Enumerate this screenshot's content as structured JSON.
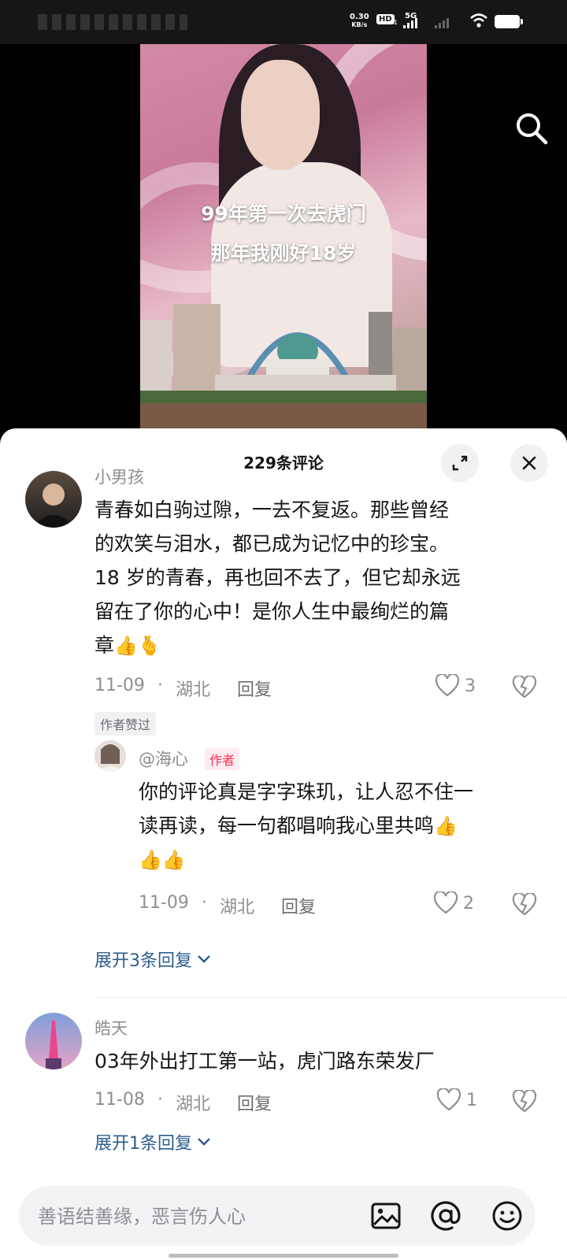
{
  "status_bar": {
    "net_speed_value": "0.30",
    "net_speed_unit": "KB/s",
    "hd_label": "HD",
    "hd_sub": "1",
    "network_label": "5G"
  },
  "video": {
    "caption_line1": "99年第一次去虎门",
    "caption_line2": "那年我刚好18岁"
  },
  "comments_sheet": {
    "title": "229条评论",
    "comments": [
      {
        "username": "小男孩",
        "text_lines": [
          "青春如白驹过隙，一去不复返。那些曾经",
          "的欢笑与泪水，都已成为记忆中的珍宝。",
          "18 岁的青春，再也回不去了，但它却永远",
          "留在了你的心中！是你人生中最绚烂的篇",
          "章"
        ],
        "emoji_inline": "👍🫰",
        "date": "11-09",
        "location": "湖北",
        "reply_label": "回复",
        "likes": "3",
        "badge": "作者赞过"
      },
      {
        "username": "@海心",
        "author_tag": "作者",
        "text_lines": [
          "你的评论真是字字珠玑，让人忍不住一",
          "读再读，每一句都唱响我心里共鸣"
        ],
        "emoji_inline": "👍",
        "emoji_line": "👍👍",
        "date": "11-09",
        "location": "湖北",
        "reply_label": "回复",
        "likes": "2"
      },
      {
        "expand_label": "展开3条回复"
      },
      {
        "username": "皓天",
        "text_lines": [
          "03年外出打工第一站，虎门路东荣发厂"
        ],
        "date": "11-08",
        "location": "湖北",
        "reply_label": "回复",
        "likes": "1",
        "expand_label": "展开1条回复"
      }
    ],
    "separator": "·"
  },
  "input_bar": {
    "placeholder": "善语结善缘，恶言伤人心"
  },
  "icons": [
    "search-icon",
    "fullscreen-icon",
    "close-icon",
    "heart-icon",
    "broken-heart-icon",
    "chevron-down-icon",
    "image-icon",
    "at-icon",
    "emoji-icon"
  ],
  "colors": {
    "accent_link": "#2e5d8f",
    "author_tag": "#fe2c55",
    "secondary_text": "#8e8e93"
  }
}
